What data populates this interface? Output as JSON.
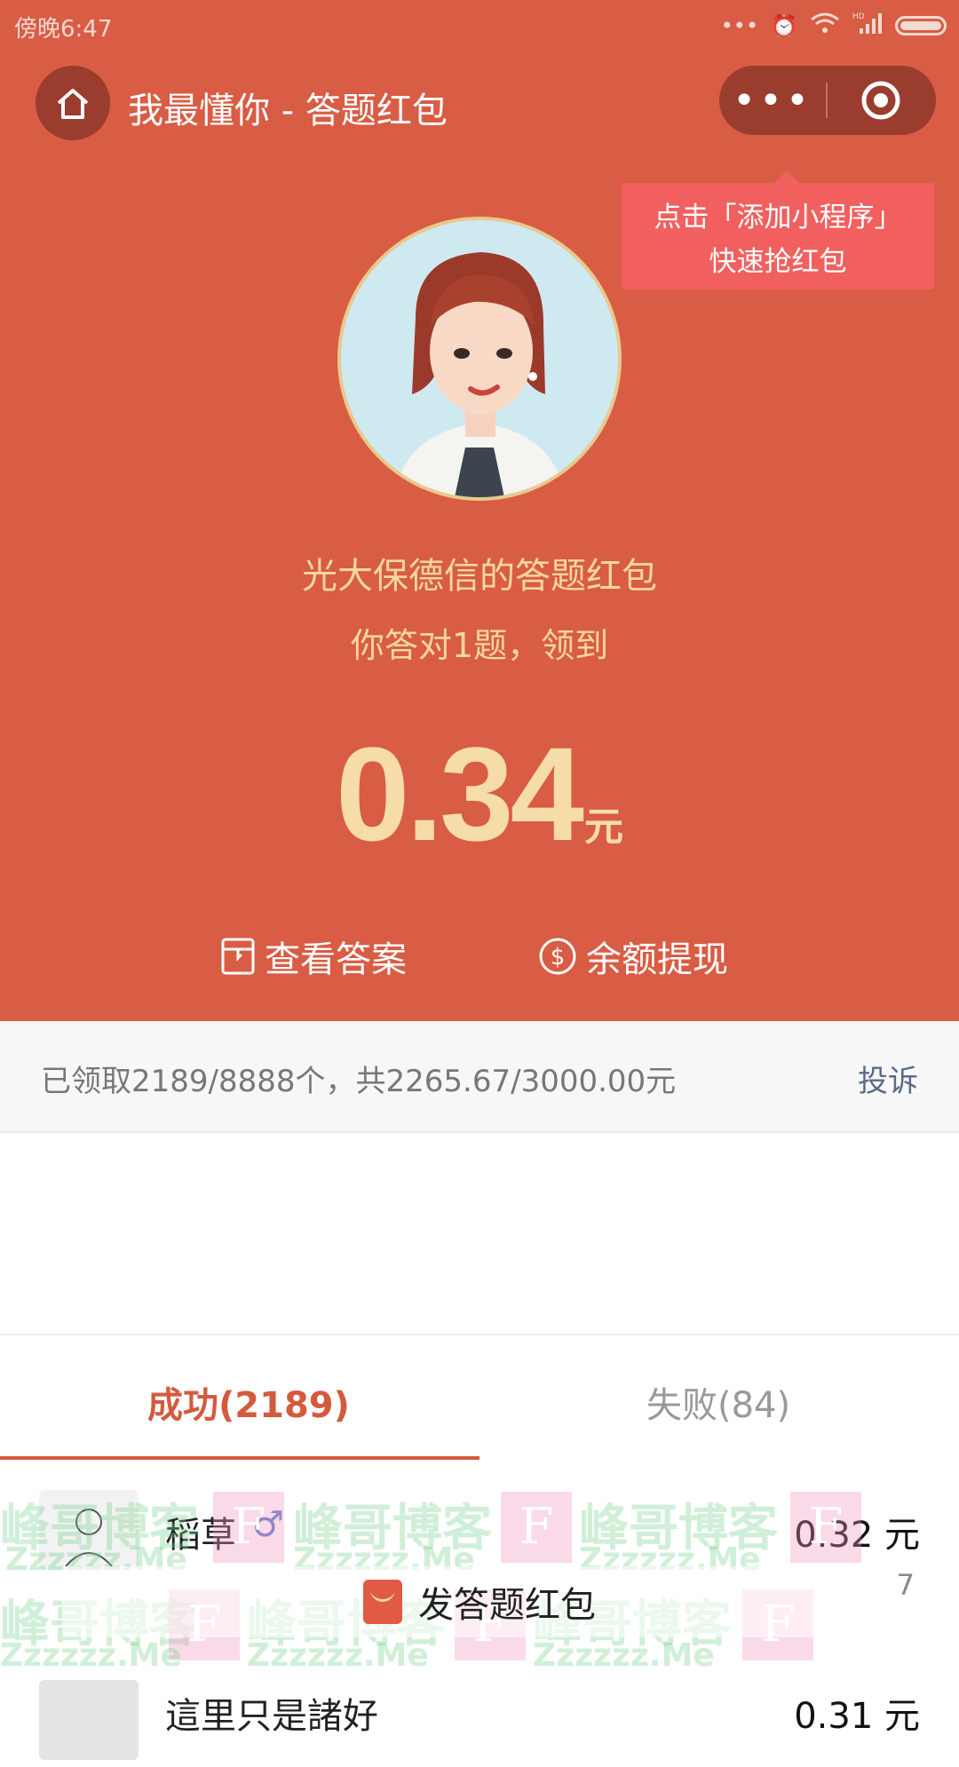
{
  "status_bar": {
    "time": "傍晚6:47",
    "network": "HD"
  },
  "nav": {
    "title": "我最懂你 - 答题红包",
    "more_label": "•••"
  },
  "tip": {
    "line1": "点击「添加小程序」",
    "line2": "快速抢红包"
  },
  "hero": {
    "sender_line": "光大保德信的答题红包",
    "result_line": "你答对1题，领到",
    "amount": "0.34",
    "unit": "元",
    "actions": [
      {
        "label": "查看答案",
        "icon": "answer-card-icon"
      },
      {
        "label": "余额提现",
        "icon": "dollar-circle-icon"
      }
    ]
  },
  "summary": {
    "text": "已领取2189/8888个，共2265.67/3000.00元",
    "complain": "投诉"
  },
  "tabs": [
    {
      "label": "成功(2189)",
      "active": true
    },
    {
      "label": "失败(84)",
      "active": false
    }
  ],
  "records": [
    {
      "name": "稻草",
      "gender_icon": "male-icon",
      "amount": "0.32 元"
    },
    {
      "name": "這里只是諸好",
      "amount": "0.31 元"
    }
  ],
  "bottom": {
    "send_label": "发答题红包",
    "counter": "7"
  },
  "watermark": {
    "brand": "峰哥博客",
    "domain": "Zzzzzz.Me",
    "logo": "F"
  },
  "colors": {
    "hero_bg": "#d95c44",
    "accent": "#d45a3e",
    "gold": "#f6dca8",
    "tip_bg": "#f1605f"
  }
}
